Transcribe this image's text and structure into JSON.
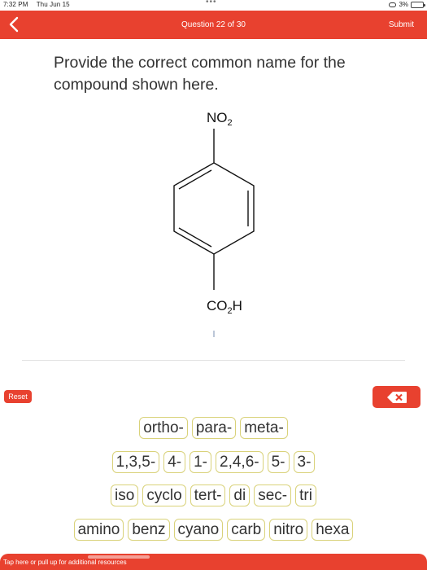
{
  "status_bar": {
    "time": "7:32 PM",
    "date": "Thu Jun 15",
    "battery": "3%"
  },
  "header": {
    "title": "Question 22 of 30",
    "submit_label": "Submit"
  },
  "question": {
    "prompt": "Provide the correct common name for the compound shown here."
  },
  "molecule": {
    "top_group": "NO",
    "top_sub": "2",
    "bottom_group_a": "CO",
    "bottom_sub": "2",
    "bottom_group_b": "H"
  },
  "controls": {
    "reset_label": "Reset"
  },
  "tiles": {
    "row1": [
      "ortho-",
      "para-",
      "meta-"
    ],
    "row2": [
      "1,3,5-",
      "4-",
      "1-",
      "2,4,6-",
      "5-",
      "3-"
    ],
    "row3": [
      "iso",
      "cyclo",
      "tert-",
      "di",
      "sec-",
      "tri"
    ],
    "row4": [
      "amino",
      "benz",
      "cyano",
      "carb",
      "nitro",
      "hexa"
    ]
  },
  "footer": {
    "hint": "Tap here or pull up for additional resources"
  },
  "colors": {
    "accent": "#e8412f",
    "tile_border": "#d9d27a"
  }
}
